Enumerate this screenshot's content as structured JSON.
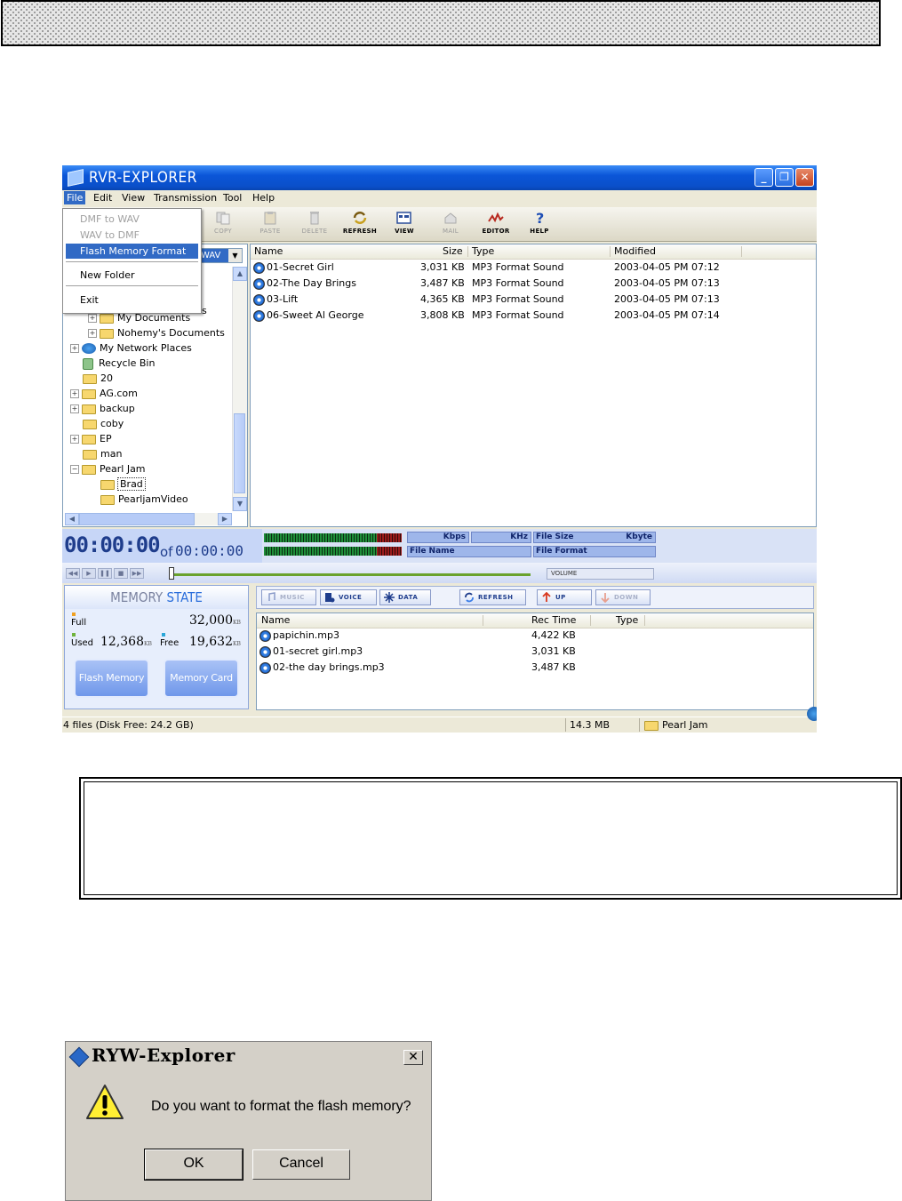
{
  "main_window": {
    "title": "RVR-EXPLORER",
    "menu": [
      "File",
      "Edit",
      "View",
      "Transmission",
      "Tool",
      "Help"
    ],
    "file_menu": {
      "items": [
        {
          "label": "DMF to WAV",
          "enabled": false
        },
        {
          "label": "WAV to DMF",
          "enabled": false
        },
        {
          "label": "Flash Memory Format",
          "enabled": true,
          "highlighted": true
        },
        {
          "label": "New Folder",
          "enabled": true
        },
        {
          "label": "Exit",
          "enabled": true
        }
      ]
    },
    "toolbar": [
      {
        "label": "COPY",
        "icon": "copy-icon",
        "enabled": false
      },
      {
        "label": "PASTE",
        "icon": "paste-icon",
        "enabled": false
      },
      {
        "label": "DELETE",
        "icon": "delete-icon",
        "enabled": false
      },
      {
        "label": "REFRESH",
        "icon": "refresh-icon",
        "enabled": true
      },
      {
        "label": "VIEW",
        "icon": "view-icon",
        "enabled": true
      },
      {
        "label": "MAIL",
        "icon": "mail-icon",
        "enabled": false
      },
      {
        "label": "EDITOR",
        "icon": "editor-icon",
        "enabled": true
      },
      {
        "label": "HELP",
        "icon": "help-icon",
        "enabled": true
      }
    ],
    "folder_combo": "WAV",
    "tree_partial": "s",
    "tree": [
      {
        "label": "My Documents",
        "icon": "folder-icon",
        "expander": "+"
      },
      {
        "label": "Nohemy's Documents",
        "icon": "folder-icon",
        "expander": "+"
      },
      {
        "label": "My Network Places",
        "icon": "network-icon",
        "expander": "+"
      },
      {
        "label": "Recycle Bin",
        "icon": "recycle-bin-icon",
        "expander": ""
      },
      {
        "label": "20",
        "icon": "folder-icon",
        "expander": ""
      },
      {
        "label": "AG.com",
        "icon": "folder-icon",
        "expander": "+"
      },
      {
        "label": "backup",
        "icon": "folder-icon",
        "expander": "+"
      },
      {
        "label": "coby",
        "icon": "folder-icon",
        "expander": ""
      },
      {
        "label": "EP",
        "icon": "folder-icon",
        "expander": "+"
      },
      {
        "label": "man",
        "icon": "folder-icon",
        "expander": ""
      },
      {
        "label": "Pearl Jam",
        "icon": "folder-open-icon",
        "expander": "-"
      },
      {
        "label": "Brad",
        "icon": "folder-icon",
        "expander": ""
      },
      {
        "label": "PearljamVideo",
        "icon": "folder-icon",
        "expander": ""
      }
    ],
    "file_list": {
      "columns": [
        "Name",
        "Size",
        "Type",
        "Modified"
      ],
      "rows": [
        {
          "name": "01-Secret Girl",
          "size": "3,031 KB",
          "type": "MP3 Format Sound",
          "modified": "2003-04-05 PM 07:12"
        },
        {
          "name": "02-The Day Brings",
          "size": "3,487 KB",
          "type": "MP3 Format Sound",
          "modified": "2003-04-05 PM 07:13"
        },
        {
          "name": "03-Lift",
          "size": "4,365 KB",
          "type": "MP3 Format Sound",
          "modified": "2003-04-05 PM 07:13"
        },
        {
          "name": "06-Sweet Al George",
          "size": "3,808 KB",
          "type": "MP3 Format Sound",
          "modified": "2003-04-05 PM 07:14"
        }
      ]
    },
    "player": {
      "time": "00:00:00",
      "of_label": "of",
      "total": "00:00:00",
      "kbps_label": "Kbps",
      "khz_label": "KHz",
      "file_size_label": "File Size",
      "kbyte_label": "Kbyte",
      "file_name_label": "File Name",
      "file_format_label": "File Format",
      "volume_label": "VOLUME"
    },
    "memory_state": {
      "title_a": "MEMORY",
      "title_b": "STATE",
      "full_label": "Full",
      "full_value": "32,000",
      "used_label": "Used",
      "used_value": "12,368",
      "free_label": "Free",
      "free_value": "19,632",
      "unit": "KB",
      "flash_button": "Flash Memory",
      "card_button": "Memory Card"
    },
    "player_buttons": [
      {
        "label": "MUSIC",
        "enabled": false
      },
      {
        "label": "VOICE",
        "enabled": true
      },
      {
        "label": "DATA",
        "enabled": true
      },
      {
        "label": "REFRESH",
        "enabled": true
      },
      {
        "label": "UP",
        "enabled": true
      },
      {
        "label": "DOWN",
        "enabled": false
      }
    ],
    "device_list": {
      "columns": [
        "Name",
        "Rec Time",
        "Type"
      ],
      "rows": [
        {
          "name": "papichin.mp3",
          "rec_time": "4,422 KB",
          "type": ""
        },
        {
          "name": "01-secret girl.mp3",
          "rec_time": "3,031 KB",
          "type": ""
        },
        {
          "name": "02-the day brings.mp3",
          "rec_time": "3,487 KB",
          "type": ""
        }
      ]
    },
    "status": {
      "files": "4 files (Disk Free: 24.2 GB)",
      "size": "14.3 MB",
      "folder": "Pearl Jam"
    }
  },
  "dialog": {
    "title": "RYW-Explorer",
    "message": "Do you want to format the flash memory?",
    "ok": "OK",
    "cancel": "Cancel"
  }
}
